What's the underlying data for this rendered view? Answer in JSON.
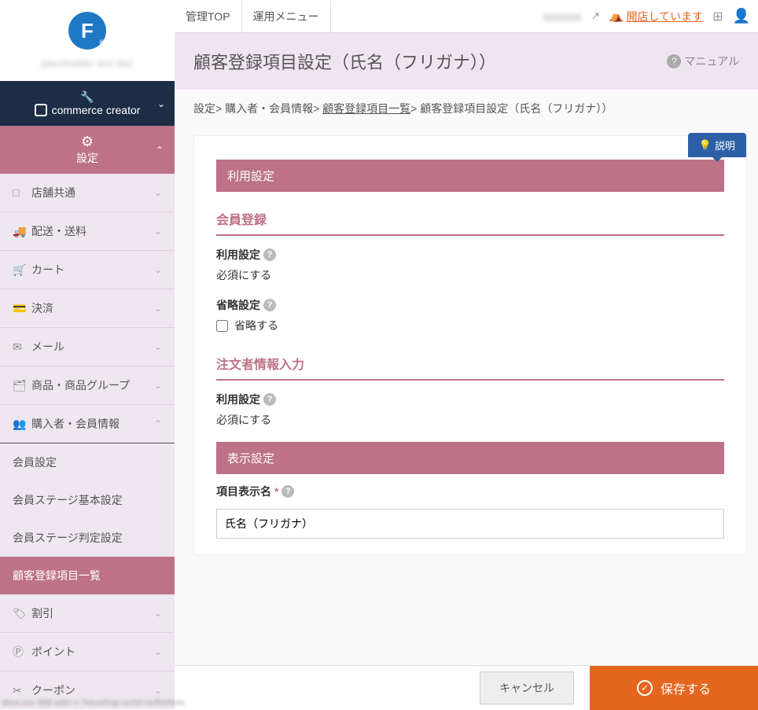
{
  "logo": {
    "letter": "F",
    "reg": "®"
  },
  "logo_subtitle": "placeholder text blur",
  "nav": {
    "commerce": "commerce creator",
    "settings": "設定"
  },
  "topbar": {
    "tab_admin": "管理TOP",
    "tab_ops": "運用メニュー",
    "user_blur": "xxxxxxx",
    "open": "開店しています"
  },
  "sidebar_items": [
    {
      "icon": "□",
      "label": "店舗共通"
    },
    {
      "icon": "🚚",
      "label": "配送・送料"
    },
    {
      "icon": "🛒",
      "label": "カート"
    },
    {
      "icon": "💳",
      "label": "決済"
    },
    {
      "icon": "✉",
      "label": "メール"
    },
    {
      "icon": "🗂",
      "label": "商品・商品グループ"
    }
  ],
  "buyer_group": {
    "icon": "👥",
    "label": "購入者・会員情報"
  },
  "buyer_sub": [
    "会員設定",
    "会員ステージ基本設定",
    "会員ステージ判定設定",
    "顧客登録項目一覧"
  ],
  "sidebar_tail": [
    {
      "icon": "🏷",
      "label": "割引"
    },
    {
      "icon": "Ⓟ",
      "label": "ポイント"
    },
    {
      "icon": "✂",
      "label": "クーポン"
    }
  ],
  "page_title": "顧客登録項目設定（氏名（フリガナ））",
  "manual": "マニュアル",
  "breadcrumb": {
    "b1": "設定",
    "b2": "購入者・会員情報",
    "b3": "顧客登録項目一覧",
    "b4": "顧客登録項目設定（氏名（フリガナ））"
  },
  "explain": "説明",
  "sections": {
    "usage_bar": "利用設定",
    "member_head": "会員登録",
    "usage_label": "利用設定",
    "usage_value": "必須にする",
    "omit_label": "省略設定",
    "omit_check": "省略する",
    "order_head": "注文者情報入力",
    "usage_label2": "利用設定",
    "usage_value2": "必須にする",
    "display_bar": "表示設定",
    "display_name_label": "項目表示名",
    "display_name_value": "氏名（フリガナ）"
  },
  "footer": {
    "cancel": "キャンセル",
    "save": "保存する"
  },
  "status_url": "itbox:xxx 886 adm i= futurehop-xx/txl=ix/fieldxxx"
}
